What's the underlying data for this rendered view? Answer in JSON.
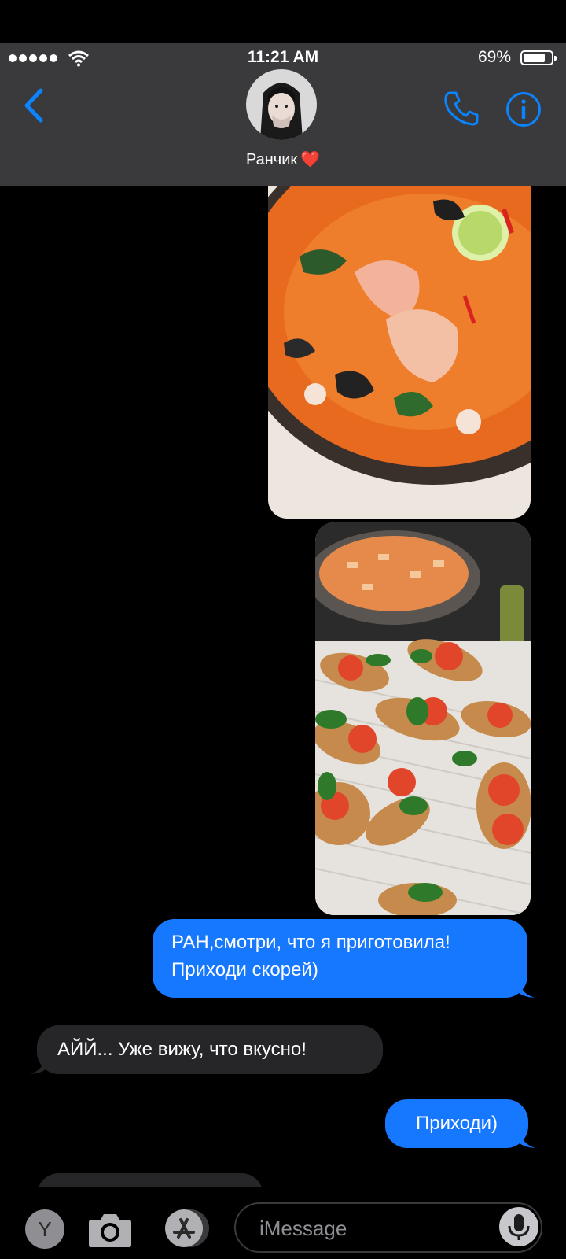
{
  "status_bar": {
    "time": "11:21 AM",
    "battery_percent": "69%",
    "battery_level": 0.69
  },
  "header": {
    "contact_name": "Ранчик",
    "contact_emoji": "❤️"
  },
  "messages": [
    {
      "from": "me",
      "text": "РАН,смотри, что я приготовила! Приходи скорей)"
    },
    {
      "from": "them",
      "text": "АЙЙ... Уже вижу, что вкусно!"
    },
    {
      "from": "me",
      "text": "Приходи)"
    }
  ],
  "photos": [
    {
      "name": "soup-photo",
      "description": "Tom yum soup with shrimp"
    },
    {
      "name": "pasta-bruschetta-photo",
      "description": "Pasta in pan and tomato bruschetta"
    }
  ],
  "composer": {
    "placeholder": "iMessage",
    "y_button_label": "Y"
  },
  "colors": {
    "sent": "#1677ff",
    "received": "#262629",
    "accent": "#0a84ff",
    "header": "#3a3a3c"
  }
}
